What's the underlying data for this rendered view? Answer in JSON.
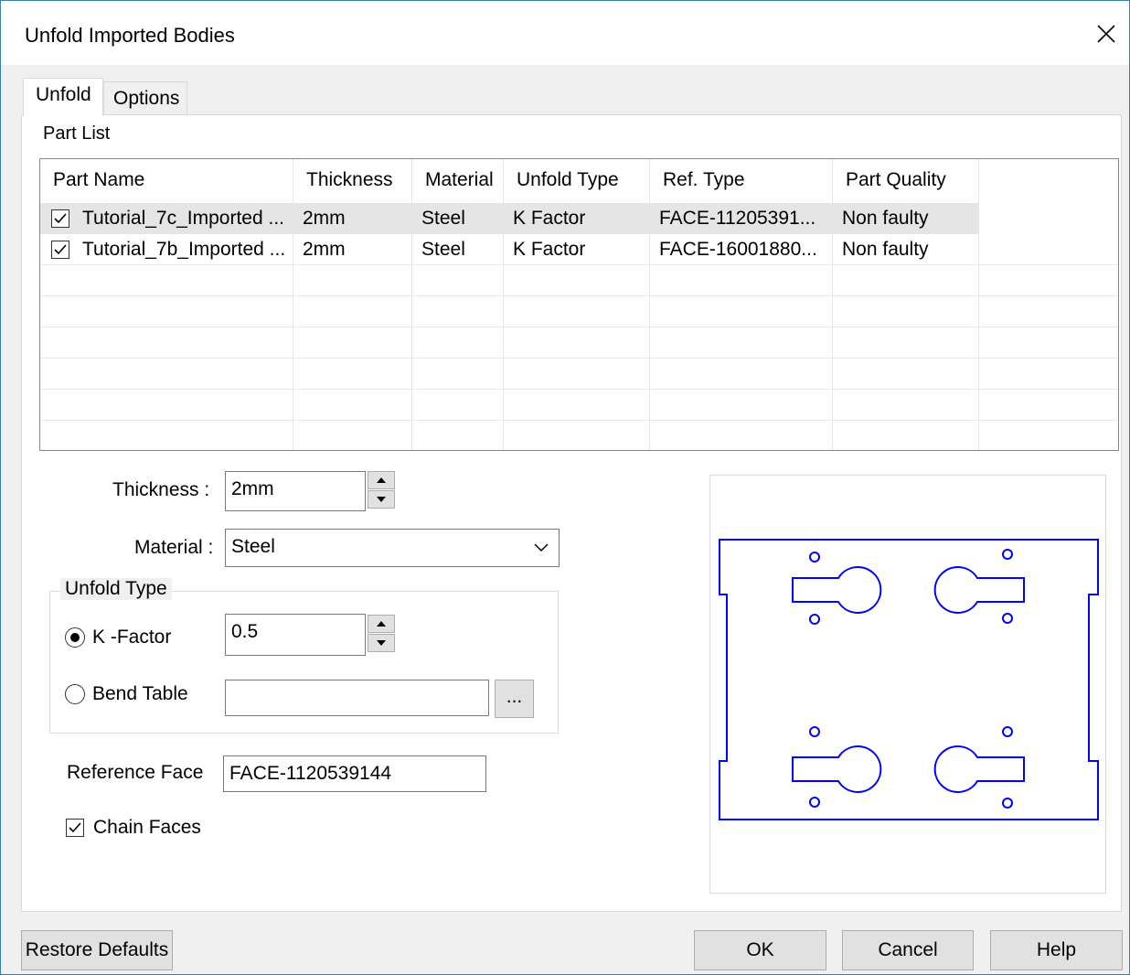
{
  "window": {
    "title": "Unfold Imported Bodies"
  },
  "tabs": [
    {
      "label": "Unfold"
    },
    {
      "label": "Options"
    }
  ],
  "part_list": {
    "label": "Part List",
    "columns": [
      "Part Name",
      "Thickness",
      "Material",
      "Unfold Type",
      "Ref. Type",
      "Part Quality"
    ],
    "rows": [
      {
        "checked": true,
        "name": "Tutorial_7c_Imported ...",
        "thickness": "2mm",
        "material": "Steel",
        "unfold_type": "K Factor",
        "ref_type": "FACE-11205391...",
        "quality": "Non faulty"
      },
      {
        "checked": true,
        "name": "Tutorial_7b_Imported ...",
        "thickness": "2mm",
        "material": "Steel",
        "unfold_type": "K Factor",
        "ref_type": "FACE-16001880...",
        "quality": "Non faulty"
      }
    ]
  },
  "form": {
    "thickness_label": "Thickness :",
    "thickness_value": "2mm",
    "material_label": "Material :",
    "material_value": "Steel",
    "unfold_type_group": "Unfold Type",
    "kfactor_label": "K -Factor",
    "kfactor_value": "0.5",
    "kfactor_selected": true,
    "bend_table_label": "Bend Table",
    "bend_table_value": "",
    "browse_label": "...",
    "reference_face_label": "Reference Face",
    "reference_face_value": "FACE-1120539144",
    "chain_faces_label": "Chain Faces",
    "chain_faces_checked": true
  },
  "preview": {
    "stroke_color": "#0000ff"
  },
  "buttons": {
    "restore_defaults": "Restore Defaults",
    "ok": "OK",
    "cancel": "Cancel",
    "help": "Help"
  }
}
